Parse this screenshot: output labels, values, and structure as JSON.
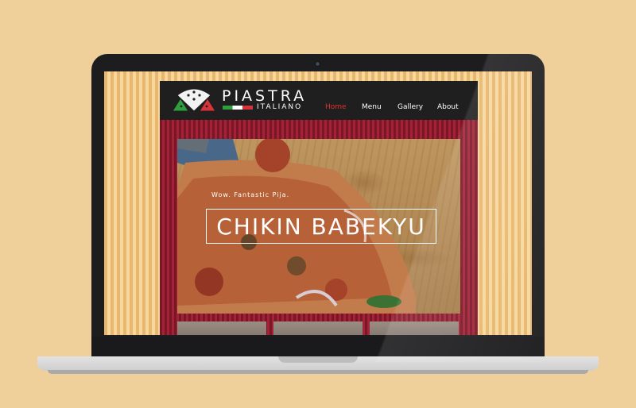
{
  "site": {
    "brand": {
      "name": "PIASTRA",
      "subtitle": "ITALIANO",
      "logo_icon": "pizza-slice-logo-icon"
    },
    "nav": [
      {
        "label": "Home",
        "active": true
      },
      {
        "label": "Menu",
        "active": false
      },
      {
        "label": "Gallery",
        "active": false
      },
      {
        "label": "About",
        "active": false
      }
    ],
    "hero": {
      "tagline": "Wow. Fantastic Pija.",
      "title": "CHIKIN BABEKYU"
    }
  },
  "colors": {
    "background": "#efd09a",
    "header": "#1f1f1f",
    "nav_active": "#e4322b",
    "body_stripes": "#a32238",
    "screen_stripes": "#e8b76a"
  }
}
